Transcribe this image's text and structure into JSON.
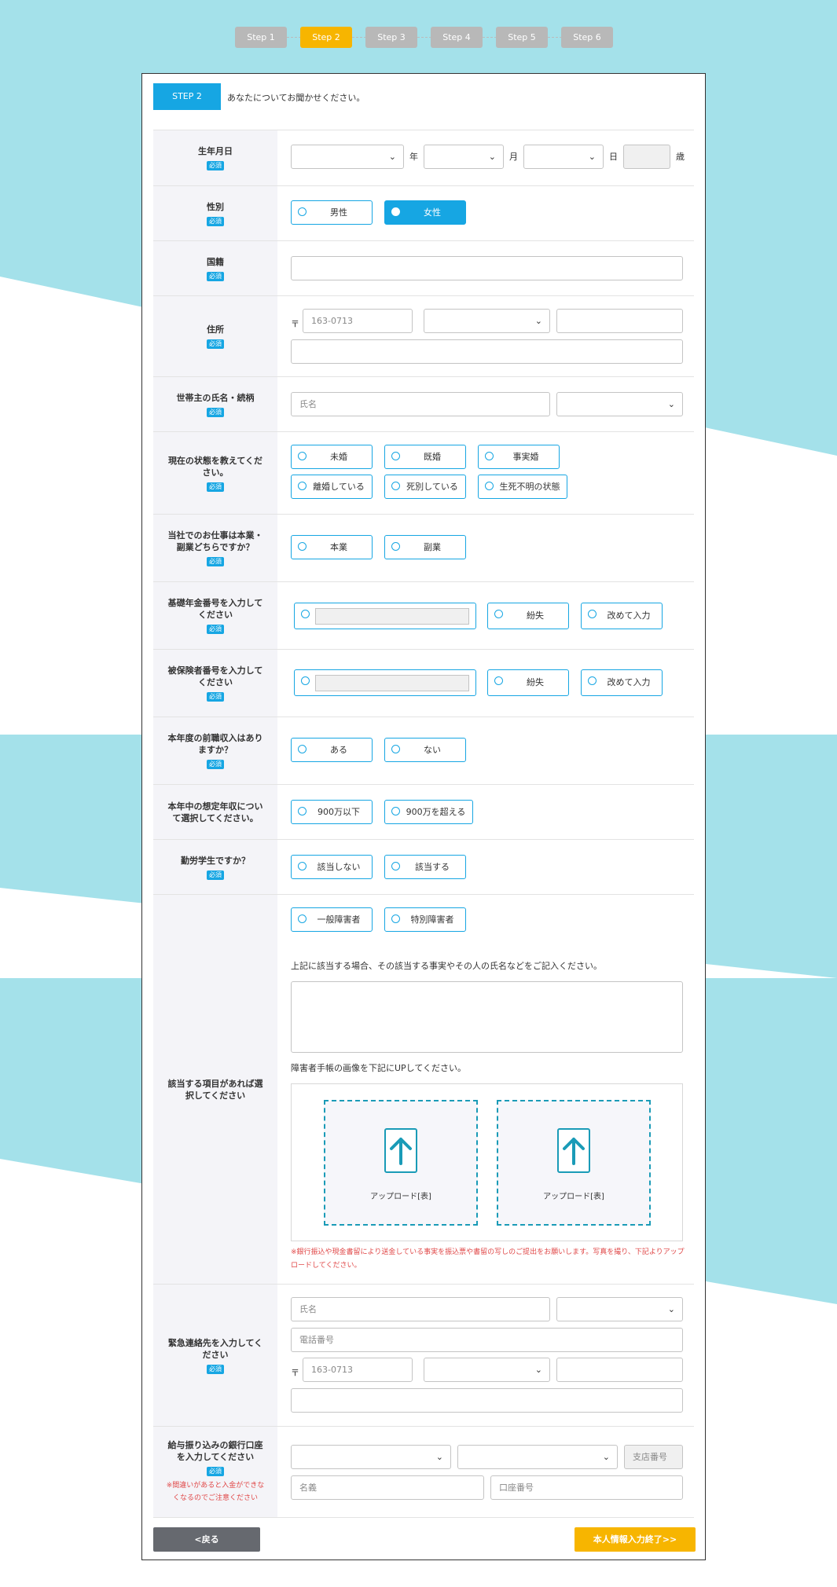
{
  "steps": [
    "Step 1",
    "Step 2",
    "Step 3",
    "Step 4",
    "Step 5",
    "Step 6"
  ],
  "active_step": 1,
  "accent_color": "#16a6e3",
  "active_color": "#f7b500",
  "header": {
    "tag": "STEP 2",
    "text": "あなたについてお聞かせください。"
  },
  "required": "必須",
  "birth": {
    "label": "生年月日",
    "year_unit": "年",
    "month_unit": "月",
    "day_unit": "日",
    "age_unit": "歳"
  },
  "gender": {
    "label": "性別",
    "options": [
      "男性",
      "女性"
    ],
    "selected": "女性"
  },
  "nationality": {
    "label": "国籍"
  },
  "address": {
    "label": "住所",
    "postal_mark": "〒",
    "postal_placeholder": "163-0713"
  },
  "householder": {
    "label": "世帯主の氏名・続柄",
    "name_placeholder": "氏名"
  },
  "marital": {
    "label": "現在の状態を教えてください。",
    "options": [
      "未婚",
      "既婚",
      "事実婚",
      "離婚している",
      "死別している",
      "生死不明の状態"
    ]
  },
  "job_type": {
    "label": "当社でのお仕事は本業・副業どちらですか？",
    "options": [
      "本業",
      "副業"
    ]
  },
  "pension": {
    "label": "基礎年金番号を入力してください",
    "options": [
      "紛失",
      "改めて入力"
    ]
  },
  "insured": {
    "label": "被保険者番号を入力してください",
    "options": [
      "紛失",
      "改めて入力"
    ]
  },
  "prev_income": {
    "label": "本年度の前職収入はありますか？",
    "options": [
      "ある",
      "ない"
    ]
  },
  "annual_income": {
    "label": "本年中の想定年収について選択してください。",
    "options": [
      "900万以下",
      "900万を超える"
    ]
  },
  "student": {
    "label": "勤労学生ですか？",
    "options": [
      "該当しない",
      "該当する"
    ]
  },
  "disability": {
    "label": "該当する項目があれば選択してください",
    "options": [
      "一般障害者",
      "特別障害者"
    ],
    "detail_text": "上記に該当する場合、その該当する事実やその人の氏名などをご記入ください。",
    "upload_text": "障害者手帳の画像を下記にUPしてください。",
    "upload_captions": [
      "アップロード[表]",
      "アップロード[表]"
    ],
    "note": "※銀行振込や現金書留により送金している事実を振込票や書留の写しのご提出をお願いします。写真を撮り、下記よりアップロードしてください。"
  },
  "emergency": {
    "label": "緊急連絡先を入力してください",
    "name_placeholder": "氏名",
    "phone_placeholder": "電話番号",
    "postal_mark": "〒",
    "postal_placeholder": "163-0713"
  },
  "bank": {
    "label": "給与振り込みの銀行口座を入力してください",
    "note": "※間違いがあると入金ができなくなるのでご注意ください",
    "branch_placeholder": "支店番号",
    "holder_placeholder": "名義",
    "account_placeholder": "口座番号"
  },
  "buttons": {
    "back": "<戻る",
    "next": "本人情報入力終了>>"
  }
}
